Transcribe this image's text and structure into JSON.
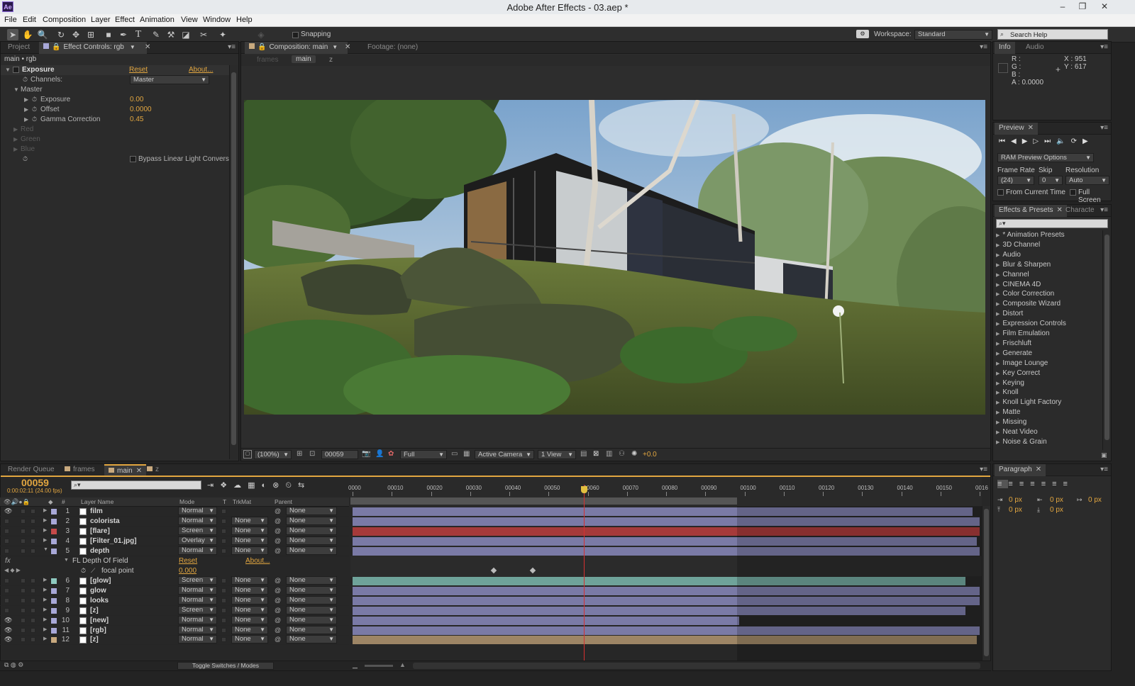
{
  "app": {
    "logo": "Ae",
    "window_title": "Adobe After Effects - 03.aep *",
    "window_controls": [
      "–",
      "❐",
      "✕"
    ]
  },
  "menu": [
    "File",
    "Edit",
    "Composition",
    "Layer",
    "Effect",
    "Animation",
    "View",
    "Window",
    "Help"
  ],
  "toolbar": {
    "snapping_label": "Snapping",
    "workspace_label": "Workspace:",
    "workspace_value": "Standard",
    "search_placeholder": "Search Help"
  },
  "effect_controls": {
    "tabs": {
      "project": "Project",
      "effect_controls": "Effect Controls: rgb"
    },
    "breadcrumb": "main • rgb",
    "effect_name": "Exposure",
    "reset_label": "Reset",
    "about_label": "About...",
    "channels_label": "Channels:",
    "channels_value": "Master",
    "master_label": "Master",
    "params": [
      {
        "label": "Exposure",
        "value": "0.00"
      },
      {
        "label": "Offset",
        "value": "0.0000"
      },
      {
        "label": "Gamma Correction",
        "value": "0.45"
      }
    ],
    "groups_disabled": [
      "Red",
      "Green",
      "Blue"
    ],
    "bypass_label": "Bypass Linear Light Convers"
  },
  "composition": {
    "tab_label": "Composition: main",
    "footage_tab": "Footage: (none)",
    "breadcrumbs": [
      "frames",
      "main",
      "z"
    ],
    "footer": {
      "zoom": "(100%)",
      "timecode": "00059",
      "resolution": "Full",
      "camera": "Active Camera",
      "views": "1 View",
      "exposure": "+0.0"
    }
  },
  "info_panel": {
    "tabs": {
      "info": "Info",
      "audio": "Audio"
    },
    "r_label": "R :",
    "g_label": "G :",
    "b_label": "B :",
    "a_label": "A :",
    "a_value": "0.0000",
    "x_label": "X : 951",
    "y_label": "Y : 617",
    "swatch_color": "#000000"
  },
  "preview_panel": {
    "tab": "Preview",
    "ram_preview": "RAM Preview Options",
    "frame_rate_label": "Frame Rate",
    "skip_label": "Skip",
    "resolution_label": "Resolution",
    "frame_rate_value": "(24)",
    "skip_value": "0",
    "resolution_value": "Auto",
    "from_current_time": "From Current Time",
    "full_screen": "Full Screen"
  },
  "effects_presets": {
    "tab": "Effects & Presets",
    "character_tab": "Characte",
    "items": [
      "* Animation Presets",
      "3D Channel",
      "Audio",
      "Blur & Sharpen",
      "Channel",
      "CINEMA 4D",
      "Color Correction",
      "Composite Wizard",
      "Distort",
      "Expression Controls",
      "Film Emulation",
      "Frischluft",
      "Generate",
      "Image Lounge",
      "Key Correct",
      "Keying",
      "Knoll",
      "Knoll Light Factory",
      "Matte",
      "Missing",
      "Neat Video",
      "Noise & Grain"
    ]
  },
  "paragraph_panel": {
    "tab": "Paragraph",
    "indent_values": [
      "0 px",
      "0 px",
      "0 px",
      "0 px",
      "0 px"
    ]
  },
  "timeline": {
    "tabs": [
      "Render Queue",
      "frames",
      "main",
      "z"
    ],
    "current_frame": "00059",
    "current_time": "0:00:02:11 (24.00 fps)",
    "columns": {
      "layer_name": "Layer Name",
      "mode": "Mode",
      "t": "T",
      "trkmat": "TrkMat",
      "parent": "Parent"
    },
    "ruler_labels": [
      "0000",
      "00010",
      "00020",
      "00030",
      "00040",
      "00050",
      "00060",
      "00070",
      "00080",
      "00090",
      "00100",
      "00110",
      "00120",
      "00130",
      "00140",
      "00150",
      "0016"
    ],
    "layers": [
      {
        "num": "1",
        "name": "film",
        "mode": "Normal",
        "trkmat": "",
        "parent": "None",
        "label_color": "#a8a8d8",
        "bar_color": "#7a7aa6",
        "bar_end": 0.989,
        "eye": true
      },
      {
        "num": "2",
        "name": "colorista",
        "mode": "Normal",
        "trkmat": "None",
        "parent": "None",
        "label_color": "#a8a8d8",
        "bar_color": "#7a7aa6",
        "bar_end": 1.0,
        "eye": false
      },
      {
        "num": "3",
        "name": "[flare]",
        "mode": "Screen",
        "trkmat": "None",
        "parent": "None",
        "label_color": "#c64a4a",
        "bar_color": "#a63a3a",
        "bar_end": 1.0,
        "eye": false
      },
      {
        "num": "4",
        "name": "[Filter_01.jpg]",
        "mode": "Overlay",
        "trkmat": "None",
        "parent": "None",
        "label_color": "#a8a8d8",
        "bar_color": "#7a7aa6",
        "bar_end": 0.995,
        "eye": false
      },
      {
        "num": "5",
        "name": "depth",
        "mode": "Normal",
        "trkmat": "None",
        "parent": "None",
        "label_color": "#a8a8d8",
        "bar_color": "#7a7aa6",
        "bar_end": 1.0,
        "eye": false
      }
    ],
    "effect_row": {
      "fx": "fx",
      "name": "FL Depth Of Field",
      "reset": "Reset",
      "about": "About..."
    },
    "property_row": {
      "name": "focal point",
      "value": "0.000",
      "keyframe_frames": [
        36,
        46
      ]
    },
    "layers2": [
      {
        "num": "6",
        "name": "[glow]",
        "mode": "Screen",
        "trkmat": "None",
        "parent": "None",
        "label_color": "#8ec9c0",
        "bar_color": "#6fa39a",
        "bar_end": 0.977,
        "eye": false
      },
      {
        "num": "7",
        "name": "glow",
        "mode": "Normal",
        "trkmat": "None",
        "parent": "None",
        "label_color": "#a8a8d8",
        "bar_color": "#7a7aa6",
        "bar_end": 1.0,
        "eye": false
      },
      {
        "num": "8",
        "name": "looks",
        "mode": "Normal",
        "trkmat": "None",
        "parent": "None",
        "label_color": "#a8a8d8",
        "bar_color": "#7a7aa6",
        "bar_end": 1.0,
        "eye": false
      },
      {
        "num": "9",
        "name": "[z]",
        "mode": "Screen",
        "trkmat": "None",
        "parent": "None",
        "label_color": "#a8a8d8",
        "bar_color": "#7a7aa6",
        "bar_end": 0.977,
        "eye": false
      },
      {
        "num": "10",
        "name": "[new]",
        "mode": "Normal",
        "trkmat": "None",
        "parent": "None",
        "label_color": "#a8a8d8",
        "bar_color": "#7a7aa6",
        "bar_end": 0.616,
        "eye": true
      },
      {
        "num": "11",
        "name": "[rgb]",
        "mode": "Normal",
        "trkmat": "None",
        "parent": "None",
        "label_color": "#a8a8d8",
        "bar_color": "#7a7aa6",
        "bar_end": 1.0,
        "eye": true
      },
      {
        "num": "12",
        "name": "[z]",
        "mode": "Normal",
        "trkmat": "None",
        "parent": "None",
        "label_color": "#c8a97e",
        "bar_color": "#9d8565",
        "bar_end": 0.995,
        "eye": true
      }
    ],
    "playhead_frame": 59,
    "work_area_end_frame": 99,
    "total_frames": 160,
    "toggle_label": "Toggle Switches / Modes"
  }
}
